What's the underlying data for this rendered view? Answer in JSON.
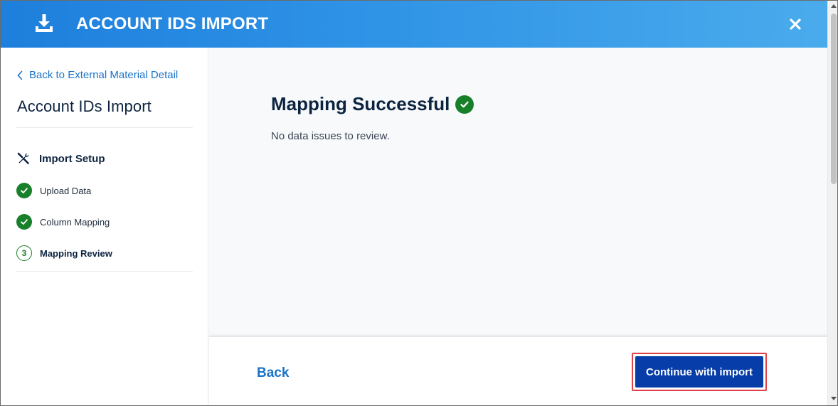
{
  "header": {
    "title": "ACCOUNT IDS IMPORT",
    "download_icon": "download-tray-icon",
    "close_icon": "close-icon",
    "gradient_start": "#1e7fdc",
    "gradient_end": "#4aabec"
  },
  "sidebar": {
    "back_link": "Back to External Material Detail",
    "title": "Account IDs Import",
    "setup_label": "Import Setup",
    "steps": [
      {
        "label": "Upload Data",
        "status": "complete"
      },
      {
        "label": "Column Mapping",
        "status": "complete"
      },
      {
        "label": "Mapping Review",
        "status": "current",
        "number": "3"
      }
    ]
  },
  "main": {
    "title": "Mapping Successful",
    "subtitle": "No data issues to review."
  },
  "footer": {
    "back_label": "Back",
    "continue_label": "Continue with import"
  },
  "colors": {
    "success": "#18802a",
    "link": "#1a73c8",
    "primary_button": "#073da8",
    "highlight_border": "#e0424a"
  }
}
